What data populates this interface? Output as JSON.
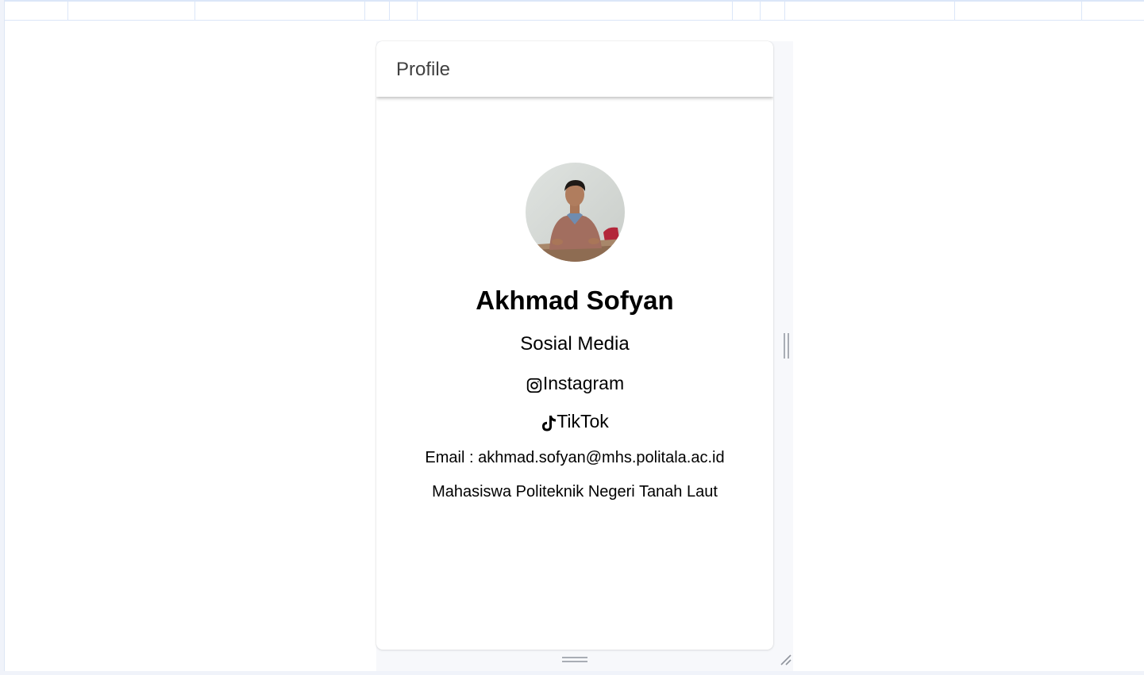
{
  "toolbar": {
    "title": "Profile"
  },
  "profile": {
    "name": "Akhmad Sofyan",
    "avatar_alt": "profile photo",
    "section_title": "Sosial Media",
    "links": [
      {
        "label": "Instagram",
        "icon": "instagram-icon"
      },
      {
        "label": "TikTok",
        "icon": "tiktok-icon"
      }
    ],
    "email_text": "Email : akhmad.sofyan@mhs.politala.ac.id",
    "description": "Mahasiswa Politeknik Negeri Tanah Laut"
  },
  "colors": {
    "page_background": "#f0f3fa",
    "card_background": "#ffffff",
    "toolbar_text": "#404040",
    "text": "#000000",
    "handle": "#a9adb5",
    "ruler_line": "#dbe6f8"
  }
}
